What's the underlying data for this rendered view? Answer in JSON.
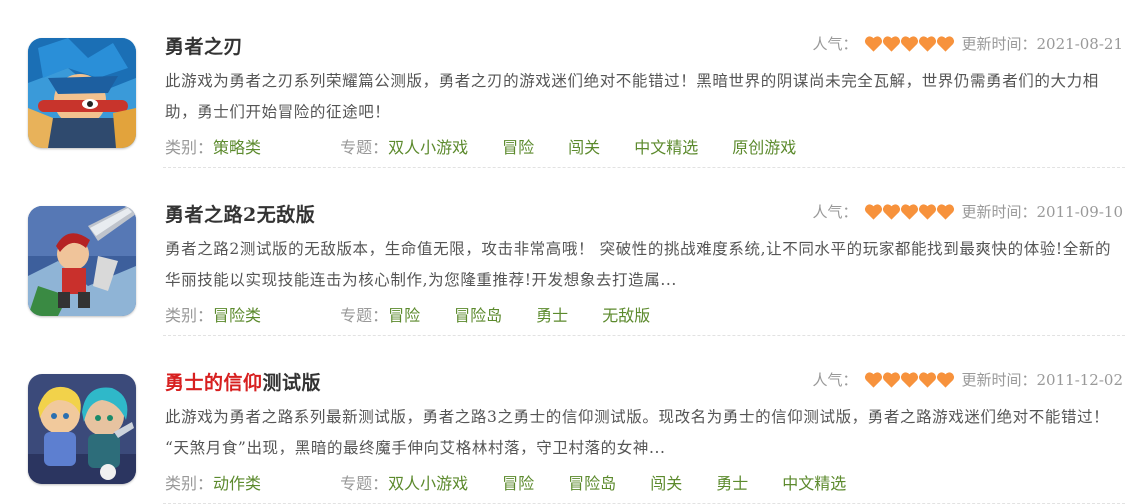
{
  "colors": {
    "tag_green": "#5c8a2d",
    "heart_orange": "#f7923c",
    "title_highlight": "#d71f1f"
  },
  "labels": {
    "popularity": "人气：",
    "update_time": "更新时间：",
    "category": "类别：",
    "topic": "专题："
  },
  "games": [
    {
      "title": "勇者之刃",
      "title_highlight": "",
      "title_rest": "勇者之刃",
      "popularity_hearts": 5,
      "date": "2021-08-21",
      "description": "此游戏为勇者之刃系列荣耀篇公测版，勇者之刃的游戏迷们绝对不能错过！黑暗世界的阴谋尚未完全瓦解，世界仍需勇者们的大力相助，勇士们开始冒险的征途吧！",
      "category": "策略类",
      "tags": [
        "双人小游戏",
        "冒险",
        "闯关",
        "中文精选",
        "原创游戏"
      ],
      "icon": "hero-blue-hair-icon"
    },
    {
      "title": "勇者之路2无敌版",
      "title_highlight": "",
      "title_rest": "勇者之路2无敌版",
      "popularity_hearts": 5,
      "date": "2011-09-10",
      "description": "勇者之路2测试版的无敌版本，生命值无限，攻击非常高哦！ 突破性的挑战难度系统,让不同水平的玩家都能找到最爽快的体验!全新的华丽技能以实现技能连击为核心制作,为您隆重推荐!开发想象去打造属...",
      "category": "冒险类",
      "tags": [
        "冒险",
        "冒险岛",
        "勇士",
        "无敌版"
      ],
      "icon": "warrior-sword-icon"
    },
    {
      "title": "勇士的信仰测试版",
      "title_highlight": "勇士的信仰",
      "title_rest": "测试版",
      "popularity_hearts": 5,
      "date": "2011-12-02",
      "description": "此游戏为勇者之路系列最新测试版，勇者之路3之勇士的信仰测试版。现改名为勇士的信仰测试版，勇者之路游戏迷们绝对不能错过！ “天煞月食”出现，黑暗的最终魔手伸向艾格林村落，守卫村落的女神...",
      "category": "动作类",
      "tags": [
        "双人小游戏",
        "冒险",
        "冒险岛",
        "闯关",
        "勇士",
        "中文精选"
      ],
      "icon": "two-heroes-icon"
    }
  ]
}
